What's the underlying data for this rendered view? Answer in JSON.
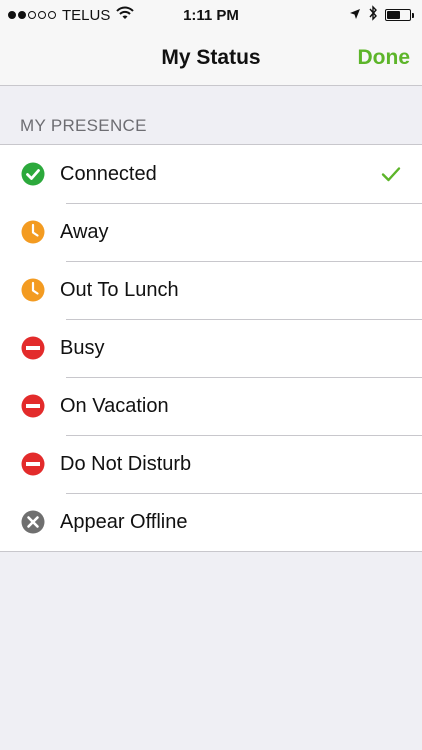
{
  "status_bar": {
    "carrier": "TELUS",
    "time": "1:11 PM",
    "signal_bars_filled": 2,
    "signal_bars_total": 5,
    "battery_level": 0.6
  },
  "nav": {
    "title": "My Status",
    "done_label": "Done"
  },
  "section": {
    "header": "MY PRESENCE"
  },
  "presence": [
    {
      "label": "Connected",
      "icon": "check-circle-icon",
      "selected": true
    },
    {
      "label": "Away",
      "icon": "clock-icon",
      "selected": false
    },
    {
      "label": "Out To Lunch",
      "icon": "clock-icon",
      "selected": false
    },
    {
      "label": "Busy",
      "icon": "no-entry-icon",
      "selected": false
    },
    {
      "label": "On Vacation",
      "icon": "no-entry-icon",
      "selected": false
    },
    {
      "label": "Do Not Disturb",
      "icon": "no-entry-icon",
      "selected": false
    },
    {
      "label": "Appear Offline",
      "icon": "x-circle-icon",
      "selected": false
    }
  ],
  "colors": {
    "accent": "#5db52a",
    "connected": "#2ca93c",
    "away": "#f39b21",
    "busy": "#e32b2b",
    "offline": "#6f6f6f"
  }
}
